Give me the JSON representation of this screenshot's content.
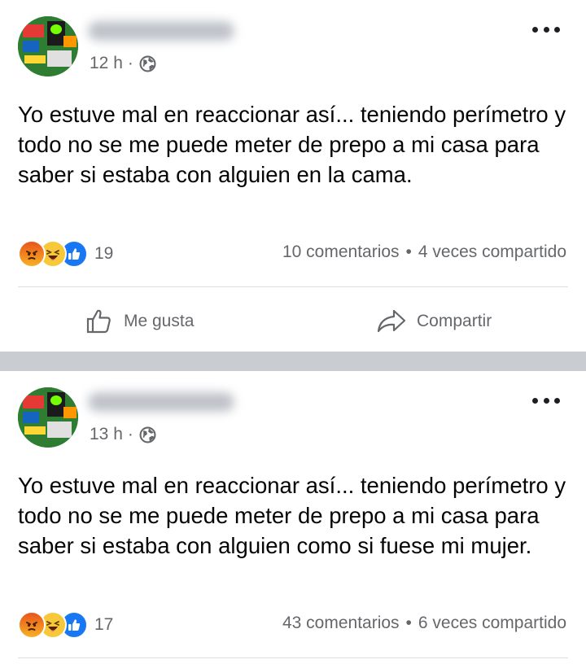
{
  "posts": [
    {
      "time": "12 h",
      "separator": "·",
      "text": "Yo estuve mal en reaccionar así... teniendo perímetro y todo no se me puede meter de prepo a mi casa para saber si estaba con alguien en la cama.",
      "reaction_icons": [
        "angry-reaction-icon",
        "haha-reaction-icon",
        "like-reaction-icon"
      ],
      "reaction_count": "19",
      "comments": "10 comentarios",
      "bullet": "•",
      "shares": "4 veces compartido",
      "like_label": "Me gusta",
      "share_label": "Compartir"
    },
    {
      "time": "13 h",
      "separator": "·",
      "text": "Yo estuve mal en reaccionar así... teniendo perímetro y todo no se me puede meter de prepo a mi casa para saber si estaba con alguien como si fuese mi mujer.",
      "reaction_icons": [
        "angry-reaction-icon",
        "haha-reaction-icon",
        "like-reaction-icon"
      ],
      "reaction_count": "17",
      "comments": "43 comentarios",
      "bullet": "•",
      "shares": "6 veces compartido"
    }
  ],
  "colors": {
    "secondary_text": "#65676b",
    "separator": "#c9ccd1",
    "like_blue": "#1877f2"
  }
}
